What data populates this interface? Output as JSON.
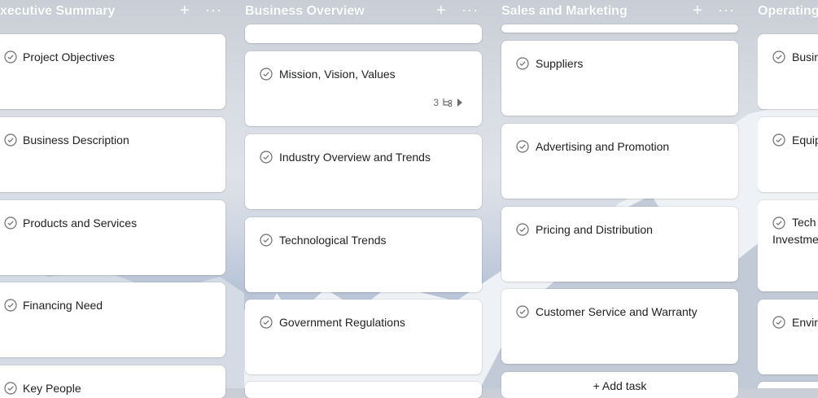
{
  "columns": [
    {
      "title": "xecutive Summary",
      "add_label": "+",
      "more_label": "···",
      "cards": [
        "Project Objectives",
        "Business Description",
        "Products and Services",
        "Financing Need",
        "Key People"
      ]
    },
    {
      "title": "Business Overview",
      "add_label": "+",
      "more_label": "···",
      "cards": [
        "Mission, Vision, Values",
        "Industry Overview and Trends",
        "Technological Trends",
        "Government Regulations"
      ],
      "subtask_count": "3"
    },
    {
      "title": "Sales and Marketing",
      "add_label": "+",
      "more_label": "···",
      "cards": [
        "Suppliers",
        "Advertising and Promotion",
        "Pricing and Distribution",
        "Customer Service and Warranty"
      ],
      "add_task_label": "+ Add task"
    },
    {
      "title": "Operating",
      "cards": [
        "Busin",
        "Equip",
        "Tech Investme",
        "Envir"
      ]
    }
  ],
  "icons": {
    "check": "check-circle-icon",
    "subtask": "subtask-icon",
    "expand": "caret-right-icon"
  }
}
